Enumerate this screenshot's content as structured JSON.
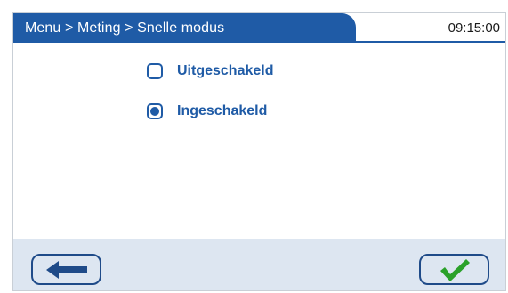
{
  "header": {
    "breadcrumb": "Menu > Meting > Snelle modus",
    "time": "09:15:00",
    "accent_color": "#1f5ba6"
  },
  "options": [
    {
      "label": "Uitgeschakeld",
      "selected": false
    },
    {
      "label": "Ingeschakeld",
      "selected": true
    }
  ],
  "footer": {
    "back_icon": "arrow-left-icon",
    "confirm_icon": "checkmark-icon",
    "confirm_color": "#2aa12a"
  }
}
